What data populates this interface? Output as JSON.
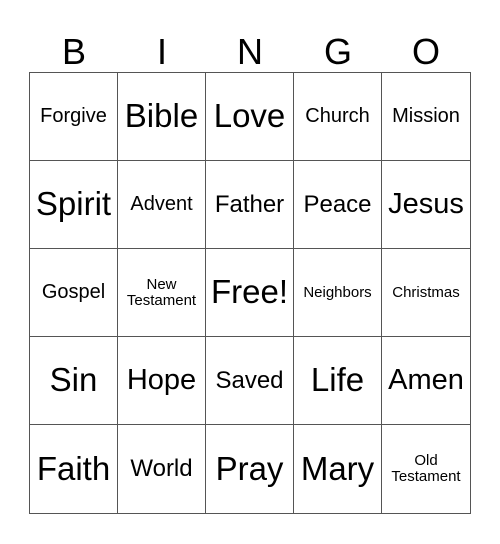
{
  "header": [
    "B",
    "I",
    "N",
    "G",
    "O"
  ],
  "cells": [
    {
      "text": "Forgive",
      "size": "s-s"
    },
    {
      "text": "Bible",
      "size": "s-xl"
    },
    {
      "text": "Love",
      "size": "s-xl"
    },
    {
      "text": "Church",
      "size": "s-s"
    },
    {
      "text": "Mission",
      "size": "s-s"
    },
    {
      "text": "Spirit",
      "size": "s-xl"
    },
    {
      "text": "Advent",
      "size": "s-s"
    },
    {
      "text": "Father",
      "size": "s-m"
    },
    {
      "text": "Peace",
      "size": "s-m"
    },
    {
      "text": "Jesus",
      "size": "s-l"
    },
    {
      "text": "Gospel",
      "size": "s-s"
    },
    {
      "text": "New Testament",
      "size": "s-xxs"
    },
    {
      "text": "Free!",
      "size": "s-xl"
    },
    {
      "text": "Neighbors",
      "size": "s-xxs"
    },
    {
      "text": "Christmas",
      "size": "s-xxs"
    },
    {
      "text": "Sin",
      "size": "s-xl"
    },
    {
      "text": "Hope",
      "size": "s-l"
    },
    {
      "text": "Saved",
      "size": "s-m"
    },
    {
      "text": "Life",
      "size": "s-xl"
    },
    {
      "text": "Amen",
      "size": "s-l"
    },
    {
      "text": "Faith",
      "size": "s-xl"
    },
    {
      "text": "World",
      "size": "s-m"
    },
    {
      "text": "Pray",
      "size": "s-xl"
    },
    {
      "text": "Mary",
      "size": "s-xl"
    },
    {
      "text": "Old Testament",
      "size": "s-xxs"
    }
  ]
}
